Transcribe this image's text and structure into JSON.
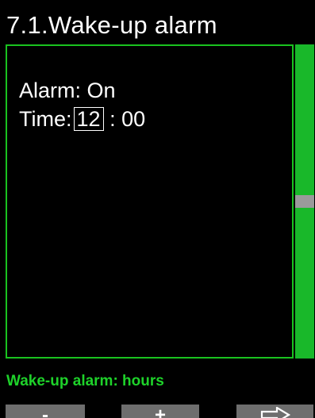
{
  "header": {
    "title": "7.1.Wake-up alarm"
  },
  "settings": {
    "alarm_label": "Alarm:",
    "alarm_value": "On",
    "time_label": "Time:",
    "time_hours": "12",
    "time_separator": ":",
    "time_minutes": "00"
  },
  "status": {
    "text": "Wake-up alarm: hours"
  },
  "softkeys": {
    "minus_label": "-",
    "plus_label": "+",
    "next_icon": "right-arrow-outline-icon"
  },
  "colors": {
    "accent_green": "#19c21f",
    "status_green": "#1ed22a",
    "softkey_gray": "#6e6e6e"
  },
  "scrollbar": {
    "position_fraction": 0.5
  }
}
